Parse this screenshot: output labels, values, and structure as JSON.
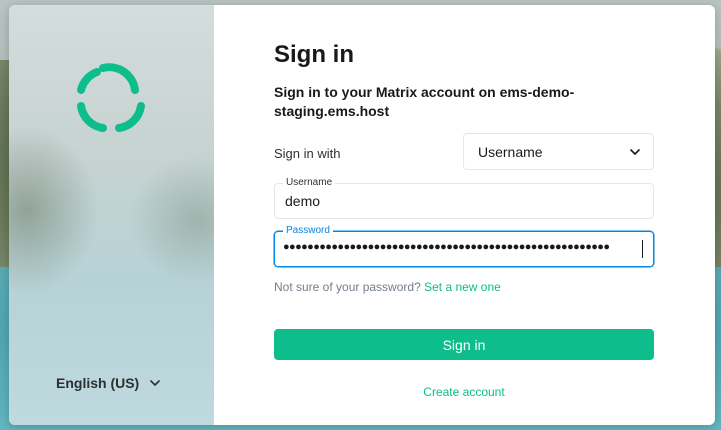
{
  "colors": {
    "accent": "#0dbd8b",
    "focus": "#0086e6",
    "text": "#17191c",
    "muted": "#737d8c"
  },
  "side": {
    "logo_icon": "element-logo-icon",
    "language": "English (US)"
  },
  "form": {
    "title": "Sign in",
    "subtitle": "Sign in to your Matrix account on ems-demo-staging.ems.host",
    "signin_with_label": "Sign in with",
    "signin_with_value": "Username",
    "username_label": "Username",
    "username_value": "demo",
    "password_label": "Password",
    "password_masked": "●●●●●●●●●●●●●●●●●●●●●●●●●●●●●●●●●●●●●●●●●●●●●●●●●●●●●●",
    "forgot_text": "Not sure of your password?",
    "forgot_link": "Set a new one",
    "submit_label": "Sign in",
    "create_account": "Create account"
  }
}
